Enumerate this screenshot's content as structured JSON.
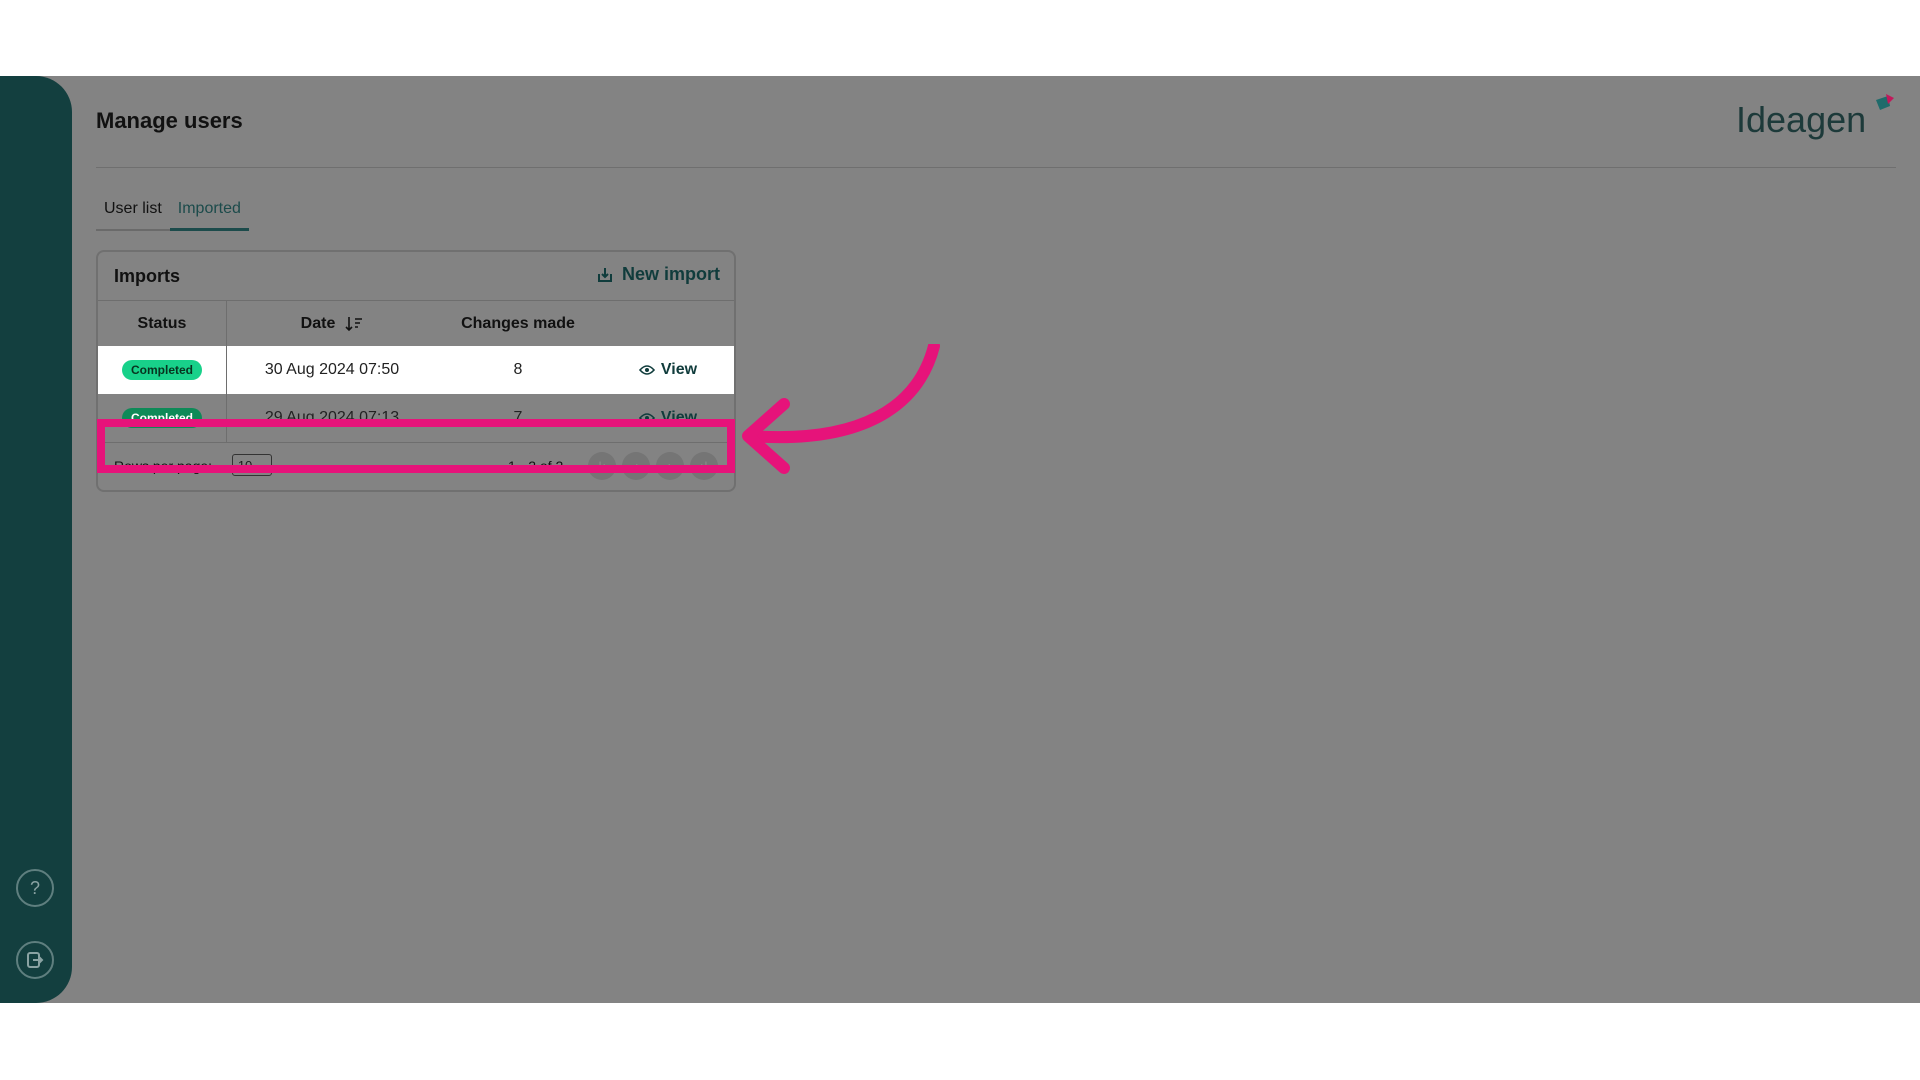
{
  "page": {
    "title": "Manage users"
  },
  "brand": {
    "logo_text": "Ideagen"
  },
  "tabs": [
    {
      "label": "User list",
      "active": false
    },
    {
      "label": "Imported",
      "active": true
    }
  ],
  "imports": {
    "title": "Imports",
    "new_import_label": "New import",
    "columns": {
      "status": "Status",
      "date": "Date",
      "changes": "Changes made"
    },
    "rows": [
      {
        "status": "Completed",
        "date": "30 Aug 2024 07:50",
        "changes": "8",
        "action": "View",
        "highlighted": true
      },
      {
        "status": "Completed",
        "date": "29 Aug 2024 07:13",
        "changes": "7",
        "action": "View",
        "highlighted": false
      }
    ],
    "footer": {
      "rows_per_page_label": "Rows per page:",
      "rows_per_page_value": "10",
      "range_text": "1 - 2 of 2"
    }
  },
  "sidebar": {
    "help_icon_label": "?"
  },
  "colors": {
    "accent": "#133f3f",
    "highlight": "#e6137a",
    "badge_green": "#18d18a"
  }
}
